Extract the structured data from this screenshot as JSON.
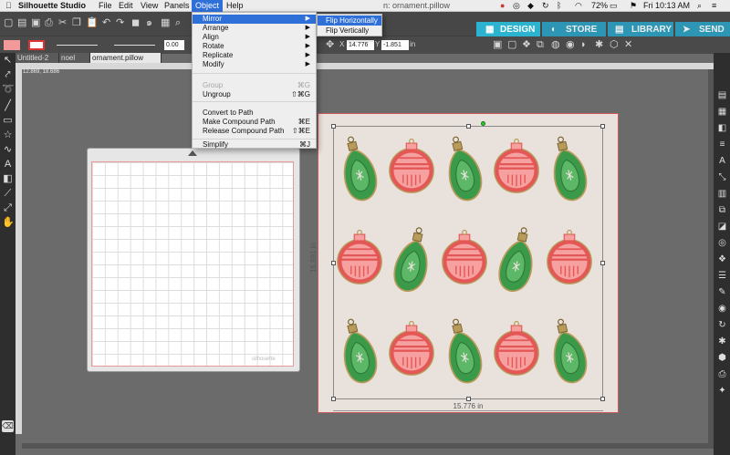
{
  "menubar": {
    "app_name": "Silhouette Studio",
    "items": [
      "File",
      "Edit",
      "View",
      "Panels",
      "Object",
      "Help"
    ],
    "clock": "Fri 10:13 AM",
    "battery": "72%",
    "window_title_fragment": "n: ornament.pillow"
  },
  "object_menu": {
    "items": [
      {
        "label": "Mirror",
        "shortcut": "",
        "submenu": true,
        "highlighted": true,
        "disabled": false
      },
      {
        "label": "Arrange",
        "shortcut": "",
        "submenu": true,
        "highlighted": false,
        "disabled": false
      },
      {
        "label": "Align",
        "shortcut": "",
        "submenu": true,
        "highlighted": false,
        "disabled": false
      },
      {
        "label": "Rotate",
        "shortcut": "",
        "submenu": true,
        "highlighted": false,
        "disabled": false
      },
      {
        "label": "Replicate",
        "shortcut": "",
        "submenu": true,
        "highlighted": false,
        "disabled": false
      },
      {
        "label": "Modify",
        "shortcut": "",
        "submenu": true,
        "highlighted": false,
        "disabled": false
      },
      {
        "label": "Group",
        "shortcut": "⌘G",
        "submenu": false,
        "highlighted": false,
        "disabled": true
      },
      {
        "label": "Ungroup",
        "shortcut": "⇧⌘G",
        "submenu": false,
        "highlighted": false,
        "disabled": false
      },
      {
        "label": "Convert to Path",
        "shortcut": "",
        "submenu": false,
        "highlighted": false,
        "disabled": false
      },
      {
        "label": "Make Compound Path",
        "shortcut": "⌘E",
        "submenu": false,
        "highlighted": false,
        "disabled": false
      },
      {
        "label": "Release Compound Path",
        "shortcut": "⇧⌘E",
        "submenu": false,
        "highlighted": false,
        "disabled": false
      },
      {
        "label": "Simplify",
        "shortcut": "⌘J",
        "submenu": false,
        "highlighted": false,
        "disabled": false
      }
    ]
  },
  "mirror_submenu": {
    "items": [
      {
        "label": "Flip Horizontally",
        "highlighted": true
      },
      {
        "label": "Flip Vertically",
        "highlighted": false
      }
    ]
  },
  "nav_tabs": [
    "DESIGN",
    "STORE",
    "LIBRARY",
    "SEND"
  ],
  "toolbar": {
    "x_label": "X",
    "x_value": "14.776",
    "y_label": "Y",
    "y_value": "-1.851",
    "unit": "in",
    "line_width": "0.00",
    "coords": "12.869, 18.686"
  },
  "doc_tabs": [
    {
      "label": "Untitled-2",
      "active": false
    },
    {
      "label": "noel",
      "active": false
    },
    {
      "label": "ornament.pillow",
      "active": true
    }
  ],
  "design": {
    "width_label": "15.776 in",
    "height_label": "15.891 in",
    "colors": {
      "green": "#3a9a4a",
      "green_light": "#5cb866",
      "red": "#e45757",
      "pink": "#f7a0a0",
      "gold": "#b89a5a",
      "background": "#e9e2dc"
    }
  },
  "mat": {
    "logo": "silhouette"
  },
  "colors": {
    "accent": "#2bb3cf",
    "menu_highlight": "#2f6fd8"
  }
}
